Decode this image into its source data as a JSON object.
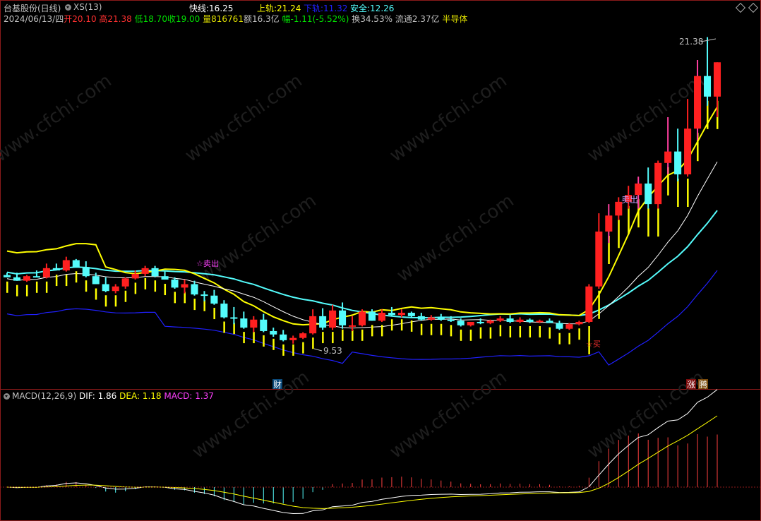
{
  "header": {
    "stock": "台基股份(日线)",
    "indicator": "XS(13)",
    "fast": {
      "label": "快线:",
      "value": "16.25"
    },
    "upper": {
      "label": "上轨:",
      "value": "21.24"
    },
    "lower": {
      "label": "下轨:",
      "value": "11.32"
    },
    "safe": {
      "label": "安全:",
      "value": "12.26"
    }
  },
  "quote": {
    "date": "2024/06/13/四",
    "open": "开20.10",
    "high": "高21.38",
    "low": "低18.70",
    "close": "收19.00",
    "volume": "量816761",
    "amount": "额16.3亿",
    "change": "幅-1.11(-5.52%)",
    "turnover": "换34.53%",
    "float": "流通2.37亿",
    "sector": "半导体"
  },
  "annotations": {
    "high_price": "21.38",
    "low_price": "9.53",
    "sell_sign": "卖出",
    "sell_small": "☆卖出",
    "buy_sign": "☆买",
    "event_cai": "财",
    "event_zhang": "涨",
    "event_teng": "腾"
  },
  "macd": {
    "title": "MACD(12,26,9)",
    "dif": "DIF: 1.86",
    "dea": "DEA: 1.18",
    "macd": "MACD: 1.37"
  },
  "watermark": "www.cfchi.com",
  "colors": {
    "up": "#ff2020",
    "down": "#54fcfc",
    "fast_line": "#ffff00",
    "upper_band": "#54fcfc",
    "lower_band": "#2020ff",
    "yellow_bar": "#ffff00",
    "pink_candle": "#ff40a0",
    "dif": "#ffffff",
    "dea": "#ffff00",
    "macd_label": "#ff40ff",
    "frame": "#8b1a1a"
  },
  "chart_data": {
    "type": "candlestick",
    "series": [
      {
        "name": "K",
        "values": [
          [
            3.1,
            3.2,
            3.0,
            3.0
          ],
          [
            3.0,
            3.2,
            2.85,
            2.85
          ],
          [
            2.85,
            3.1,
            2.8,
            3.05
          ],
          [
            3.05,
            3.3,
            3.0,
            3.0
          ],
          [
            3.0,
            3.6,
            2.95,
            3.4
          ],
          [
            3.4,
            3.6,
            3.3,
            3.3
          ],
          [
            3.3,
            3.9,
            3.25,
            3.75
          ],
          [
            3.75,
            3.8,
            3.45,
            3.45
          ],
          [
            3.45,
            3.7,
            3.0,
            3.05
          ],
          [
            3.05,
            3.2,
            2.7,
            2.7
          ],
          [
            2.7,
            3.0,
            2.35,
            2.4
          ],
          [
            2.4,
            2.7,
            2.3,
            2.6
          ],
          [
            2.6,
            3.0,
            2.5,
            2.95
          ],
          [
            2.95,
            3.3,
            2.9,
            3.15
          ],
          [
            3.15,
            3.5,
            3.05,
            3.4
          ],
          [
            3.4,
            3.5,
            3.0,
            3.05
          ],
          [
            3.05,
            3.3,
            2.9,
            2.9
          ],
          [
            2.9,
            3.0,
            2.5,
            2.55
          ],
          [
            2.55,
            2.9,
            2.3,
            2.7
          ],
          [
            2.7,
            2.85,
            2.2,
            2.25
          ],
          [
            2.25,
            2.4,
            1.95,
            2.2
          ],
          [
            2.2,
            2.45,
            1.8,
            1.85
          ],
          [
            1.85,
            2.0,
            1.2,
            1.25
          ],
          [
            1.25,
            1.7,
            0.95,
            1.2
          ],
          [
            1.2,
            1.5,
            0.75,
            0.8
          ],
          [
            0.8,
            1.3,
            0.6,
            1.15
          ],
          [
            1.15,
            1.4,
            0.6,
            0.65
          ],
          [
            0.65,
            0.8,
            0.4,
            0.5
          ],
          [
            0.5,
            0.7,
            0.2,
            0.25
          ],
          [
            0.25,
            0.45,
            0.1,
            0.35
          ],
          [
            0.35,
            0.6,
            0.3,
            0.55
          ],
          [
            0.55,
            1.6,
            0.5,
            1.3
          ],
          [
            1.3,
            1.65,
            0.7,
            0.8
          ],
          [
            0.8,
            1.8,
            0.7,
            1.55
          ],
          [
            1.55,
            1.9,
            0.75,
            0.9
          ],
          [
            0.9,
            1.3,
            0.65,
            0.9
          ],
          [
            0.9,
            1.6,
            0.85,
            1.5
          ],
          [
            1.5,
            1.6,
            1.1,
            1.1
          ],
          [
            1.1,
            1.6,
            1.05,
            1.45
          ],
          [
            1.45,
            1.7,
            1.3,
            1.35
          ],
          [
            1.35,
            1.6,
            1.25,
            1.45
          ],
          [
            1.45,
            1.5,
            1.25,
            1.3
          ],
          [
            1.3,
            1.45,
            1.1,
            1.15
          ],
          [
            1.15,
            1.35,
            1.1,
            1.25
          ],
          [
            1.25,
            1.4,
            1.1,
            1.15
          ],
          [
            1.15,
            1.3,
            1.05,
            1.1
          ],
          [
            1.1,
            1.2,
            0.85,
            0.9
          ],
          [
            0.9,
            1.05,
            0.85,
            1.05
          ],
          [
            1.05,
            1.2,
            0.95,
            1.0
          ],
          [
            1.0,
            1.15,
            0.95,
            1.1
          ],
          [
            1.1,
            1.3,
            1.05,
            1.2
          ],
          [
            1.2,
            1.35,
            1.0,
            1.05
          ],
          [
            1.05,
            1.25,
            1.0,
            1.15
          ],
          [
            1.15,
            1.2,
            1.0,
            1.05
          ],
          [
            1.05,
            1.15,
            1.0,
            1.1
          ],
          [
            1.1,
            1.2,
            1.0,
            1.0
          ],
          [
            1.0,
            1.1,
            0.7,
            0.75
          ],
          [
            0.75,
            1.0,
            0.7,
            0.95
          ],
          [
            0.95,
            1.1,
            0.9,
            1.05
          ],
          [
            1.05,
            2.7,
            1.0,
            2.6
          ],
          [
            2.6,
            5.8,
            2.5,
            5.0
          ],
          [
            5.0,
            6.2,
            4.5,
            5.7
          ],
          [
            5.7,
            6.5,
            5.5,
            6.3
          ],
          [
            6.3,
            7.0,
            6.0,
            6.6
          ],
          [
            6.6,
            7.4,
            6.0,
            7.1
          ],
          [
            7.1,
            7.8,
            6.0,
            6.2
          ],
          [
            6.2,
            8.1,
            6.0,
            8.0
          ],
          [
            8.0,
            10.0,
            7.5,
            8.5
          ],
          [
            8.5,
            9.5,
            7.2,
            7.5
          ],
          [
            7.5,
            10.8,
            7.4,
            9.5
          ],
          [
            9.5,
            12.5,
            9.0,
            11.8
          ],
          [
            11.8,
            13.5,
            10.5,
            10.9
          ],
          [
            10.9,
            12.4,
            10.0,
            12.4
          ]
        ]
      }
    ],
    "xlabel": "",
    "ylabel": ""
  }
}
